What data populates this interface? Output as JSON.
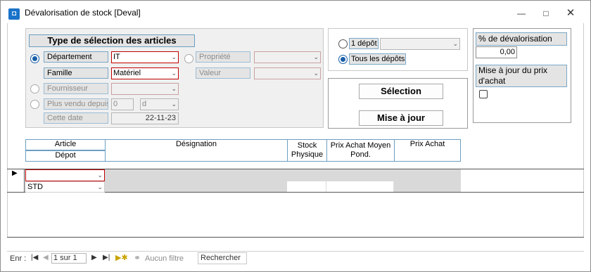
{
  "window": {
    "title": "Dévalorisation de stock [Deval]",
    "minimize_icon": "minimize-icon",
    "maximize_icon": "maximize-icon",
    "close_icon": "close-icon"
  },
  "selection": {
    "heading": "Type de sélection des articles",
    "departement_label": "Département",
    "departement_value": "IT",
    "famille_label": "Famille",
    "famille_value": "Matériel",
    "fournisseur_label": "Fournisseur",
    "fournisseur_value": "",
    "plus_vendu_label": "Plus vendu depuis",
    "plus_vendu_value": "0",
    "plus_vendu_unit": "d",
    "cette_date_label": "Cette date",
    "cette_date_value": "22-11-23",
    "propriete_label": "Propriété",
    "valeur_label": "Valeur"
  },
  "depot": {
    "un_depot_label": "1 dépôt",
    "tous_depots_label": "Tous les dépôts",
    "selected": "Tous les dépôts"
  },
  "actions": {
    "selection_label": "Sélection",
    "mise_a_jour_label": "Mise à jour"
  },
  "devalorisation": {
    "pct_label": "% de dévalorisation",
    "pct_value": "0,00",
    "maj_prix_label": "Mise à jour du prix d'achat",
    "maj_prix_checked": false
  },
  "grid": {
    "headers": {
      "article": "Article",
      "depot": "Dépot",
      "designation": "Désignation",
      "stock": "Stock Physique",
      "prix_moyen": "Prix Achat Moyen Pond.",
      "prix_achat": "Prix Achat"
    },
    "rows": [
      {
        "article": "",
        "depot": "STD",
        "designation": "",
        "stock": "",
        "prix_moyen": "",
        "prix_achat": ""
      }
    ]
  },
  "statusbar": {
    "enr_label": "Enr :",
    "record_position": "1 sur 1",
    "filter_label": "Aucun filtre",
    "search_label": "Rechercher"
  }
}
